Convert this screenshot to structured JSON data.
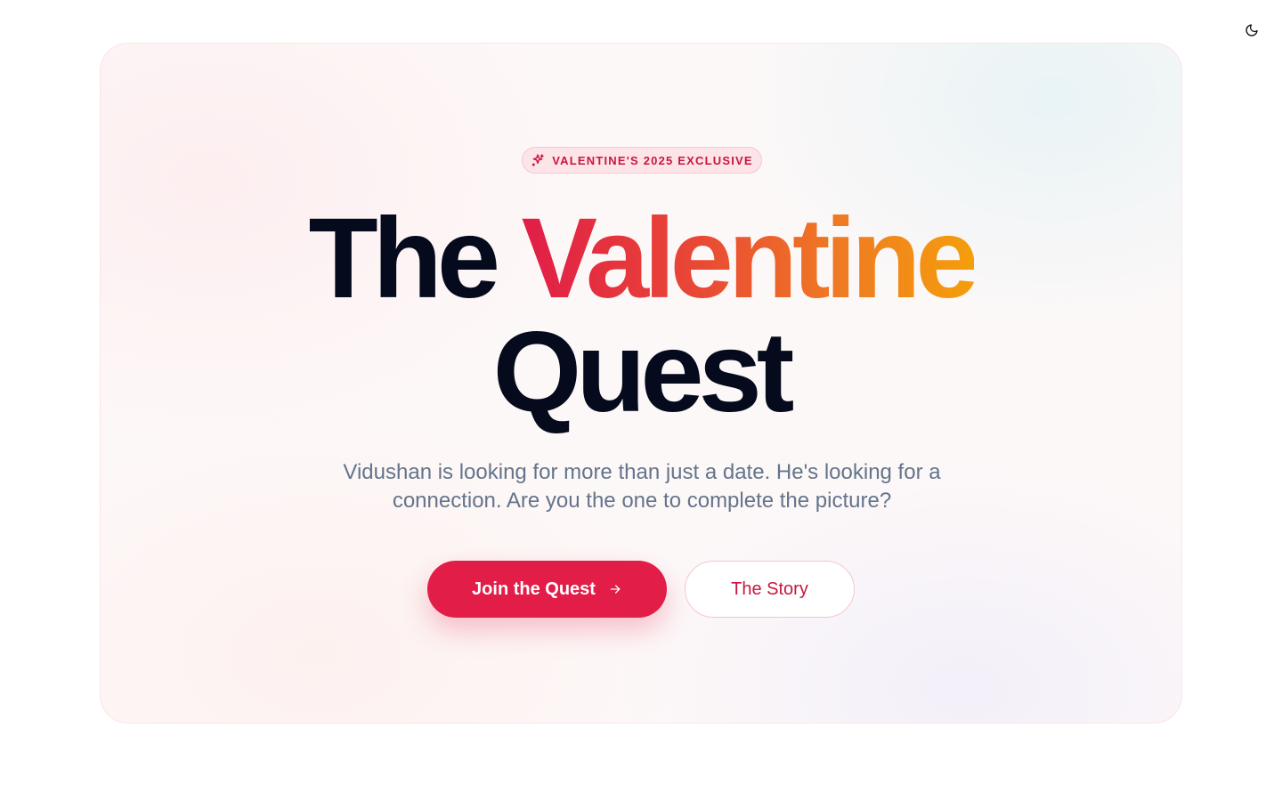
{
  "header": {
    "theme_toggle_icon": "moon-icon"
  },
  "hero": {
    "badge": {
      "icon": "sparkle-icon",
      "label": "VALENTINE'S 2025 EXCLUSIVE"
    },
    "title": {
      "word_1": "The",
      "word_2_highlight": "Valentine",
      "word_3": "Quest"
    },
    "subtitle": "Vidushan is looking for more than just a date. He's looking for a connection. Are you the one to complete the picture?",
    "primary_button": {
      "label": "Join the Quest",
      "icon": "arrow-right-icon"
    },
    "secondary_button": {
      "label": "The Story"
    }
  },
  "colors": {
    "accent": "#e11d48",
    "gradient_start": "#e11d48",
    "gradient_end": "#f59e0b",
    "heading": "#050b1c",
    "body_text": "#64748b"
  }
}
